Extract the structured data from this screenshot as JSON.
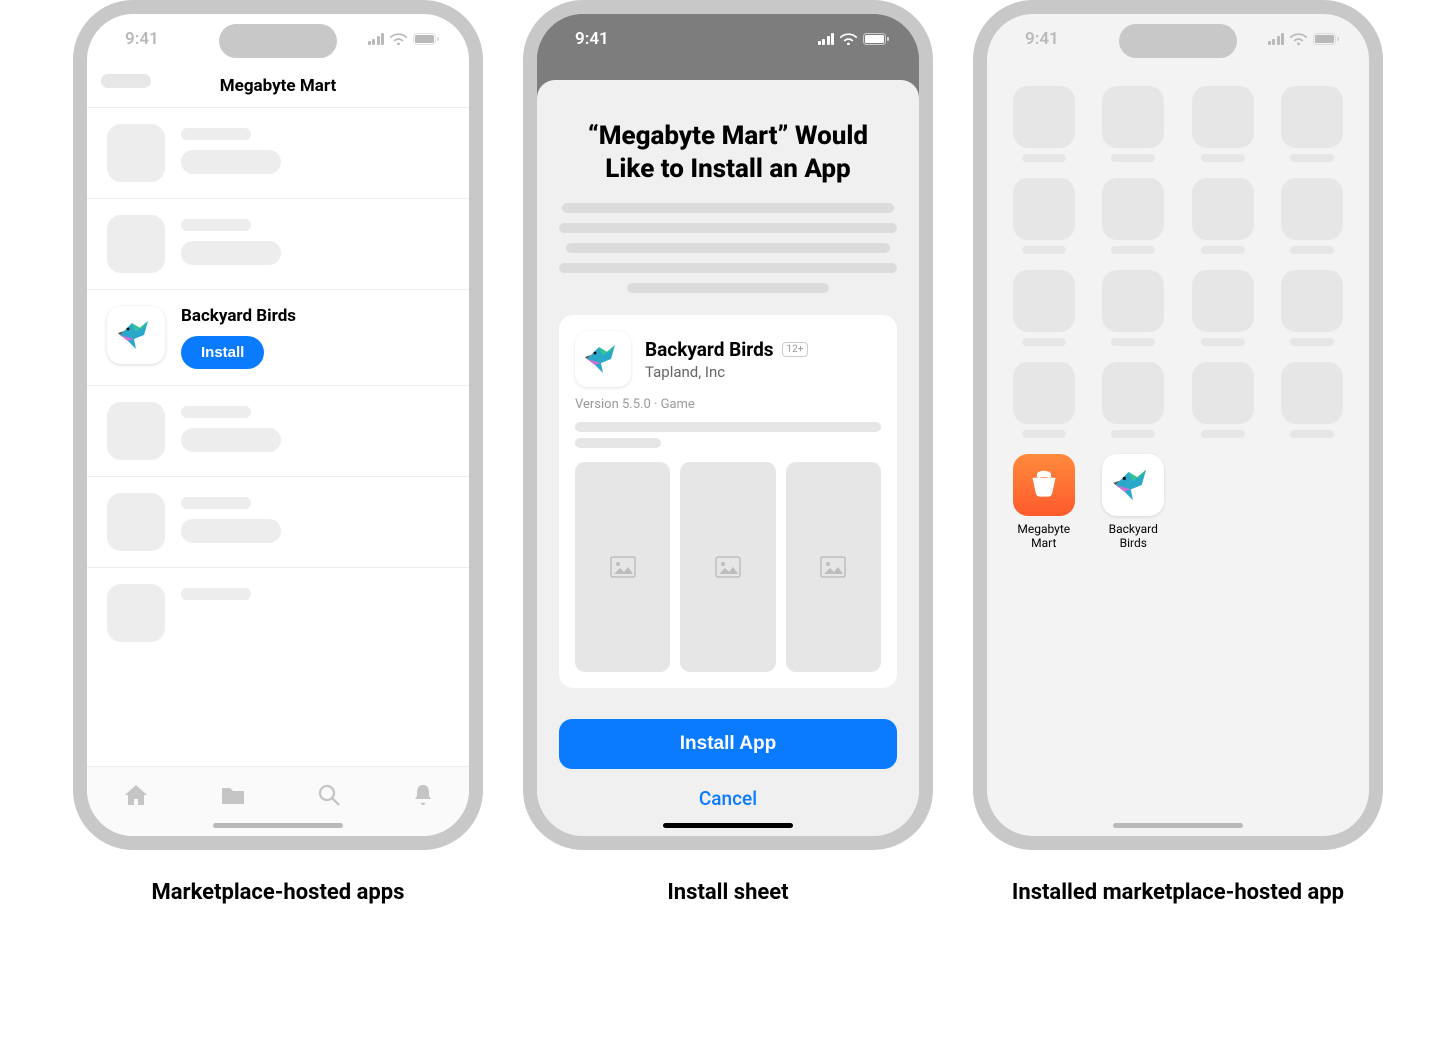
{
  "status_time": "9:41",
  "phone1": {
    "nav_title": "Megabyte Mart",
    "app_name": "Backyard Birds",
    "install_label": "Install"
  },
  "phone2": {
    "sheet_title": "“Megabyte Mart” Would Like to Install an App",
    "app_name": "Backyard Birds",
    "developer": "Tapland, Inc",
    "age_rating": "12+",
    "meta_line": "Version 5.5.0 · Game",
    "install_btn": "Install App",
    "cancel_btn": "Cancel"
  },
  "phone3": {
    "app1_name": "Megabyte Mart",
    "app2_name": "Backyard Birds"
  },
  "captions": {
    "c1": "Marketplace-hosted apps",
    "c2": "Install sheet",
    "c3": "Installed marketplace-hosted app"
  }
}
